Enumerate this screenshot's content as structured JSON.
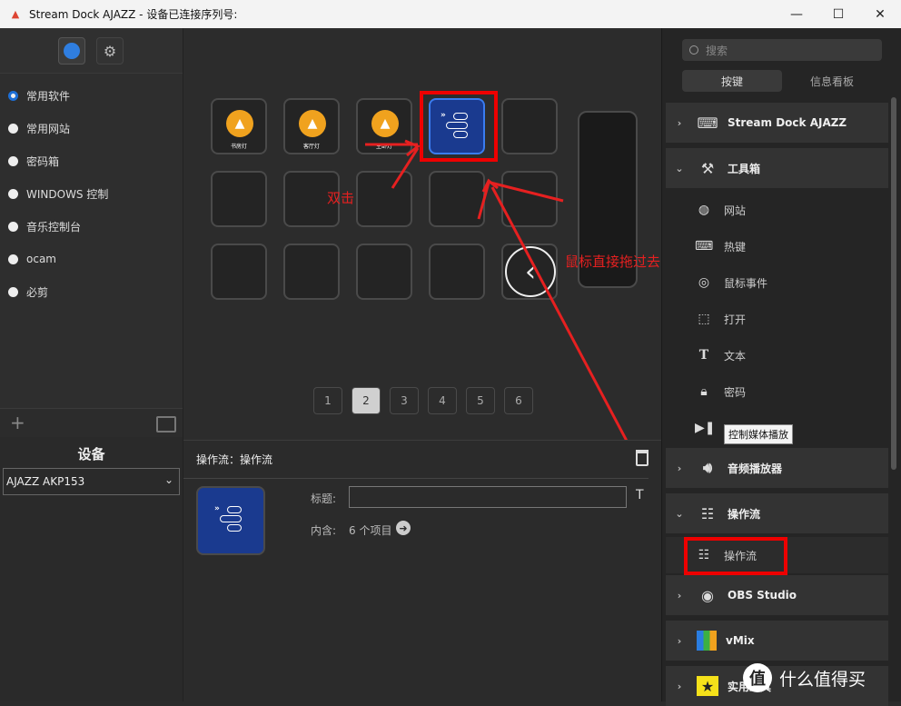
{
  "window": {
    "title": "Stream Dock AJAZZ - 设备已连接序列号:",
    "minimize": "—",
    "maximize": "☐",
    "close": "✕"
  },
  "profiles": [
    {
      "label": "常用软件",
      "selected": true
    },
    {
      "label": "常用网站",
      "selected": false
    },
    {
      "label": "密码箱",
      "selected": false
    },
    {
      "label": "WINDOWS 控制",
      "selected": false
    },
    {
      "label": "音乐控制台",
      "selected": false
    },
    {
      "label": "ocam",
      "selected": false
    },
    {
      "label": "必剪",
      "selected": false
    }
  ],
  "left_bar": {
    "add": "+"
  },
  "device": {
    "heading": "设备",
    "selected": "AJAZZ AKP153"
  },
  "keys": [
    {
      "label": "书房灯"
    },
    {
      "label": "客厅灯"
    },
    {
      "label": "主卧灯"
    }
  ],
  "back_glyph": "‹",
  "pages": [
    "1",
    "2",
    "3",
    "4",
    "5",
    "6"
  ],
  "current_page": "2",
  "annotations": {
    "double_click": "双击",
    "drag": "鼠标直接拖过去"
  },
  "inspector": {
    "header": "操作流：操作流",
    "title_label": "标题:",
    "title_value": "",
    "title_format": "T",
    "contains_label": "内含:",
    "contains_value": "6 个项目",
    "contains_arrow": "➜"
  },
  "right_panel": {
    "search_placeholder": "搜索",
    "tabs": [
      "按键",
      "信息看板"
    ],
    "active_tab": "按键",
    "categories": [
      {
        "label": "Stream Dock AJAZZ",
        "expanded": false,
        "icon": "keyboard-icon"
      },
      {
        "label": "工具箱",
        "expanded": true,
        "icon": "toolbox-icon"
      },
      {
        "label": "音频播放器",
        "expanded": false,
        "icon": "speaker-icon"
      },
      {
        "label": "操作流",
        "expanded": true,
        "icon": "flow-icon"
      },
      {
        "label": "OBS Studio",
        "expanded": false,
        "icon": "obs-icon"
      },
      {
        "label": "vMix",
        "expanded": false,
        "icon": "vmix-icon"
      },
      {
        "label": "实用工具",
        "expanded": false,
        "icon": "utility-icon"
      }
    ],
    "toolbox_actions": [
      {
        "label": "网站",
        "icon": "globe-icon"
      },
      {
        "label": "热键",
        "icon": "hotkey-icon"
      },
      {
        "label": "鼠标事件",
        "icon": "mouse-icon"
      },
      {
        "label": "打开",
        "icon": "open-icon"
      },
      {
        "label": "文本",
        "icon": "text-icon"
      },
      {
        "label": "密码",
        "icon": "lock-icon"
      },
      {
        "label": "",
        "icon": "play-pause-icon"
      }
    ],
    "tooltip": "控制媒体播放",
    "flow_actions": [
      {
        "label": "操作流",
        "icon": "flow-icon"
      }
    ]
  },
  "watermark": {
    "badge": "值",
    "text": "什么值得买"
  },
  "colors": {
    "accent": "#1d6fd6",
    "annotation_red": "#e00000",
    "bulb": "#f0a21e",
    "flow_key": "#1a3a8f"
  }
}
